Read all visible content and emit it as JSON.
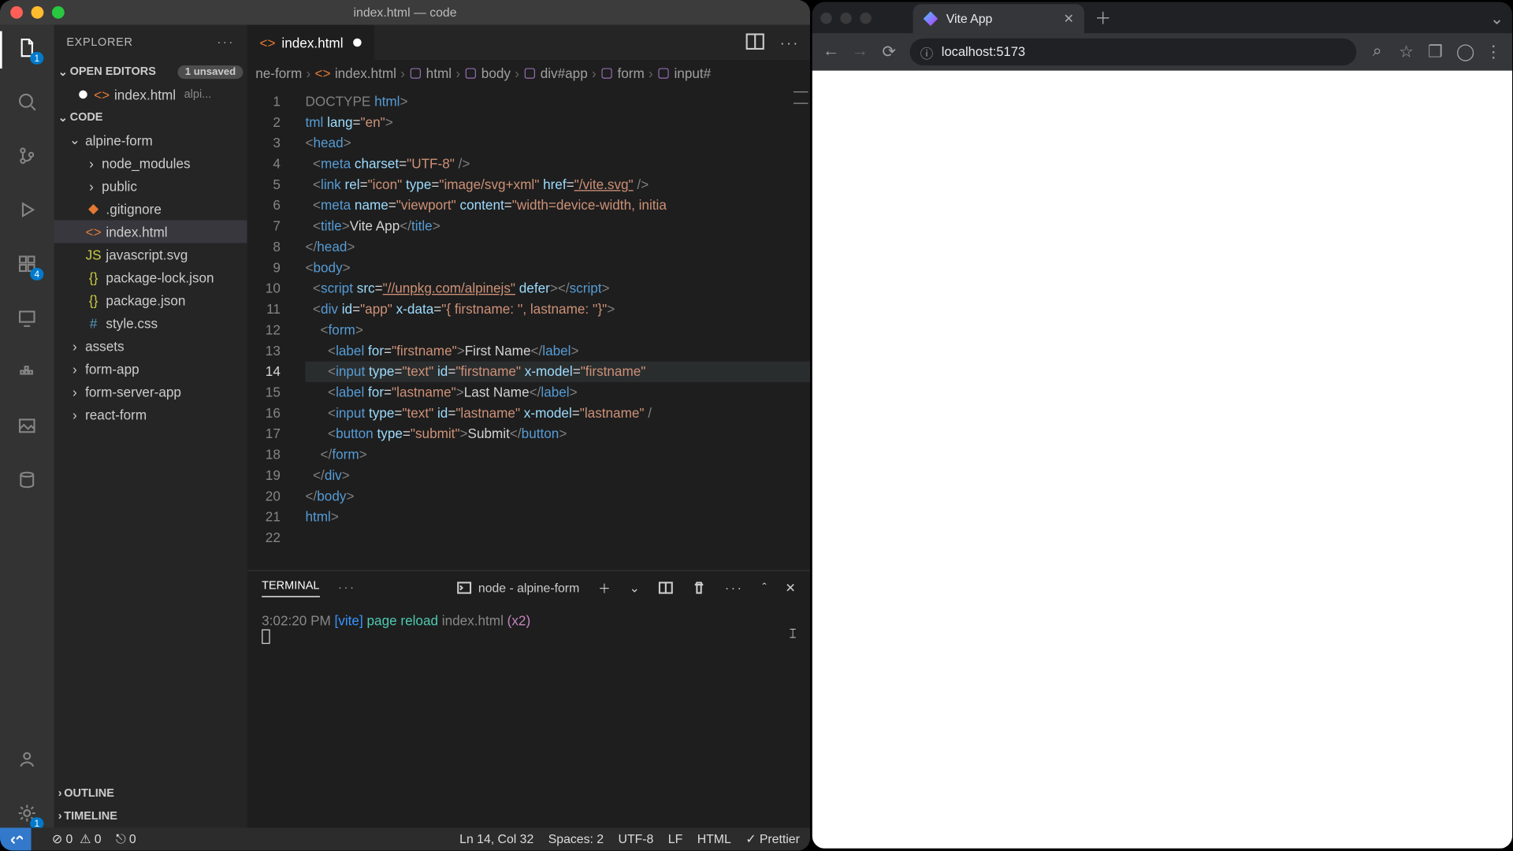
{
  "vscode": {
    "title": "index.html — code",
    "explorer_title": "EXPLORER",
    "open_editors_label": "OPEN EDITORS",
    "unsaved_badge": "1 unsaved",
    "open_file": "index.html",
    "open_file_hint": "alpi...",
    "workspace_name": "CODE",
    "tree": {
      "folder0": "alpine-form",
      "nm": "node_modules",
      "public": "public",
      "gitignore": ".gitignore",
      "index": "index.html",
      "jssvg": "javascript.svg",
      "pkglock": "package-lock.json",
      "pkg": "package.json",
      "style": "style.css",
      "assets": "assets",
      "formapp": "form-app",
      "formserver": "form-server-app",
      "reactform": "react-form"
    },
    "outline": "OUTLINE",
    "timeline": "TIMELINE",
    "tab_name": "index.html",
    "crumbs": [
      "ne-form",
      "index.html",
      "html",
      "body",
      "div#app",
      "form",
      "input#"
    ],
    "code_lines": [
      {
        "n": 1,
        "html": "<span class='t-grey'>DOCTYPE</span> <span class='t-blue'>html</span><span class='t-grey'>&gt;</span>"
      },
      {
        "n": 2,
        "html": "<span class='t-blue'>tml</span> <span class='t-lblue'>lang</span>=<span class='t-str'>\"en\"</span><span class='t-grey'>&gt;</span>"
      },
      {
        "n": 3,
        "html": "<span class='t-grey'>&lt;</span><span class='t-blue'>head</span><span class='t-grey'>&gt;</span>"
      },
      {
        "n": 4,
        "html": "  <span class='t-grey'>&lt;</span><span class='t-blue'>meta</span> <span class='t-lblue'>charset</span>=<span class='t-str'>\"UTF-8\"</span> <span class='t-grey'>/&gt;</span>"
      },
      {
        "n": 5,
        "html": "  <span class='t-grey'>&lt;</span><span class='t-blue'>link</span> <span class='t-lblue'>rel</span>=<span class='t-str'>\"icon\"</span> <span class='t-lblue'>type</span>=<span class='t-str'>\"image/svg+xml\"</span> <span class='t-lblue'>href</span>=<span class='t-link'>\"/vite.svg\"</span> <span class='t-grey'>/&gt;</span>"
      },
      {
        "n": 6,
        "html": "  <span class='t-grey'>&lt;</span><span class='t-blue'>meta</span> <span class='t-lblue'>name</span>=<span class='t-str'>\"viewport\"</span> <span class='t-lblue'>content</span>=<span class='t-str'>\"width=device-width, initia</span>"
      },
      {
        "n": 7,
        "html": "  <span class='t-grey'>&lt;</span><span class='t-blue'>title</span><span class='t-grey'>&gt;</span>Vite App<span class='t-grey'>&lt;/</span><span class='t-blue'>title</span><span class='t-grey'>&gt;</span>"
      },
      {
        "n": 8,
        "html": "<span class='t-grey'>&lt;/</span><span class='t-blue'>head</span><span class='t-grey'>&gt;</span>"
      },
      {
        "n": 9,
        "html": "<span class='t-grey'>&lt;</span><span class='t-blue'>body</span><span class='t-grey'>&gt;</span>"
      },
      {
        "n": 10,
        "html": "  <span class='t-grey'>&lt;</span><span class='t-blue'>script</span> <span class='t-lblue'>src</span>=<span class='t-link'>\"//unpkg.com/alpinejs\"</span> <span class='t-lblue'>defer</span><span class='t-grey'>&gt;&lt;/</span><span class='t-blue'>script</span><span class='t-grey'>&gt;</span>"
      },
      {
        "n": 11,
        "html": "  <span class='t-grey'>&lt;</span><span class='t-blue'>div</span> <span class='t-lblue'>id</span>=<span class='t-str'>\"app\"</span> <span class='t-lblue'>x-data</span>=<span class='t-str'>\"{ firstname: '', lastname: ''}\"</span><span class='t-grey'>&gt;</span>"
      },
      {
        "n": 12,
        "html": "    <span class='t-grey'>&lt;</span><span class='t-blue'>form</span><span class='t-grey'>&gt;</span>"
      },
      {
        "n": 13,
        "html": "      <span class='t-grey'>&lt;</span><span class='t-blue'>label</span> <span class='t-lblue'>for</span>=<span class='t-str'>\"firstname\"</span><span class='t-grey'>&gt;</span>First Name<span class='t-grey'>&lt;/</span><span class='t-blue'>label</span><span class='t-grey'>&gt;</span>"
      },
      {
        "n": 14,
        "cur": true,
        "html": "      <span class='t-grey'>&lt;</span><span class='t-blue'>input</span> <span class='t-lblue'>type</span>=<span class='t-str'>\"text\"</span> <span class='t-lblue'>id</span>=<span class='t-str'>\"firstname\"</span> <span class='t-lblue'>x-model</span>=<span class='t-str'>\"firstname\"</span>"
      },
      {
        "n": 15,
        "html": "      <span class='t-grey'>&lt;</span><span class='t-blue'>label</span> <span class='t-lblue'>for</span>=<span class='t-str'>\"lastname\"</span><span class='t-grey'>&gt;</span>Last Name<span class='t-grey'>&lt;/</span><span class='t-blue'>label</span><span class='t-grey'>&gt;</span>"
      },
      {
        "n": 16,
        "html": "      <span class='t-grey'>&lt;</span><span class='t-blue'>input</span> <span class='t-lblue'>type</span>=<span class='t-str'>\"text\"</span> <span class='t-lblue'>id</span>=<span class='t-str'>\"lastname\"</span> <span class='t-lblue'>x-model</span>=<span class='t-str'>\"lastname\"</span> <span class='t-grey'>/</span>"
      },
      {
        "n": 17,
        "html": "      <span class='t-grey'>&lt;</span><span class='t-blue'>button</span> <span class='t-lblue'>type</span>=<span class='t-str'>\"submit\"</span><span class='t-grey'>&gt;</span>Submit<span class='t-grey'>&lt;/</span><span class='t-blue'>button</span><span class='t-grey'>&gt;</span>"
      },
      {
        "n": 18,
        "html": "    <span class='t-grey'>&lt;/</span><span class='t-blue'>form</span><span class='t-grey'>&gt;</span>"
      },
      {
        "n": 19,
        "html": "  <span class='t-grey'>&lt;/</span><span class='t-blue'>div</span><span class='t-grey'>&gt;</span>"
      },
      {
        "n": 20,
        "html": "<span class='t-grey'>&lt;/</span><span class='t-blue'>body</span><span class='t-grey'>&gt;</span>"
      },
      {
        "n": 21,
        "html": "<span class='t-blue'>html</span><span class='t-grey'>&gt;</span>"
      },
      {
        "n": 22,
        "html": ""
      }
    ],
    "terminal": {
      "tab": "TERMINAL",
      "process": "node - alpine-form",
      "line_time": "3:02:20 PM ",
      "line_tag": "[vite]",
      "line_action": " page reload ",
      "line_file": "index.html",
      "line_count": " (x2)"
    },
    "status": {
      "errors": "0",
      "warnings": "0",
      "ports": "0",
      "cursor": "Ln 14, Col 32",
      "indent": "Spaces: 2",
      "encoding": "UTF-8",
      "eol": "LF",
      "lang": "HTML",
      "prettier": "Prettier"
    },
    "activity_badges": {
      "explorer": "1",
      "ext": "4",
      "settings": "1"
    }
  },
  "browser": {
    "tab_title": "Vite App",
    "url": "localhost:5173"
  }
}
